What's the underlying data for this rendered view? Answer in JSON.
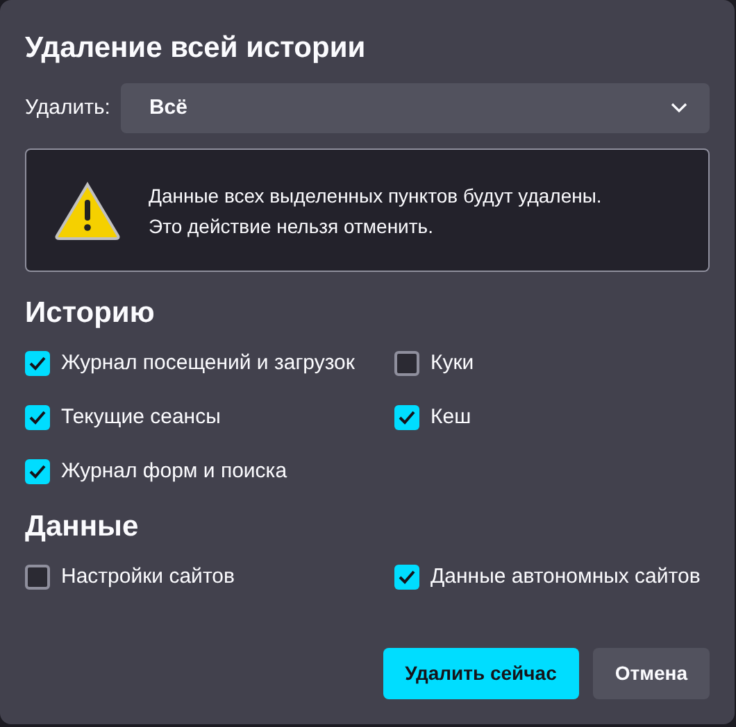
{
  "title": "Удаление всей истории",
  "range": {
    "label": "Удалить:",
    "value": "Всё"
  },
  "warning": {
    "lines": [
      "Данные всех выделенных пунктов будут удалены.",
      "Это действие нельзя отменить."
    ]
  },
  "sections": [
    {
      "heading": "Историю",
      "items": [
        {
          "label": "Журнал посещений и загрузок",
          "checked": true
        },
        {
          "label": "Куки",
          "checked": false
        },
        {
          "label": "Текущие сеансы",
          "checked": true
        },
        {
          "label": "Кеш",
          "checked": true
        },
        {
          "label": "Журнал форм и поиска",
          "checked": true
        }
      ]
    },
    {
      "heading": "Данные",
      "items": [
        {
          "label": "Настройки сайтов",
          "checked": false
        },
        {
          "label": "Данные автономных сайтов",
          "checked": true
        }
      ]
    }
  ],
  "buttons": [
    {
      "label": "Удалить сейчас",
      "kind": "primary"
    },
    {
      "label": "Отмена",
      "kind": "secondary"
    }
  ]
}
